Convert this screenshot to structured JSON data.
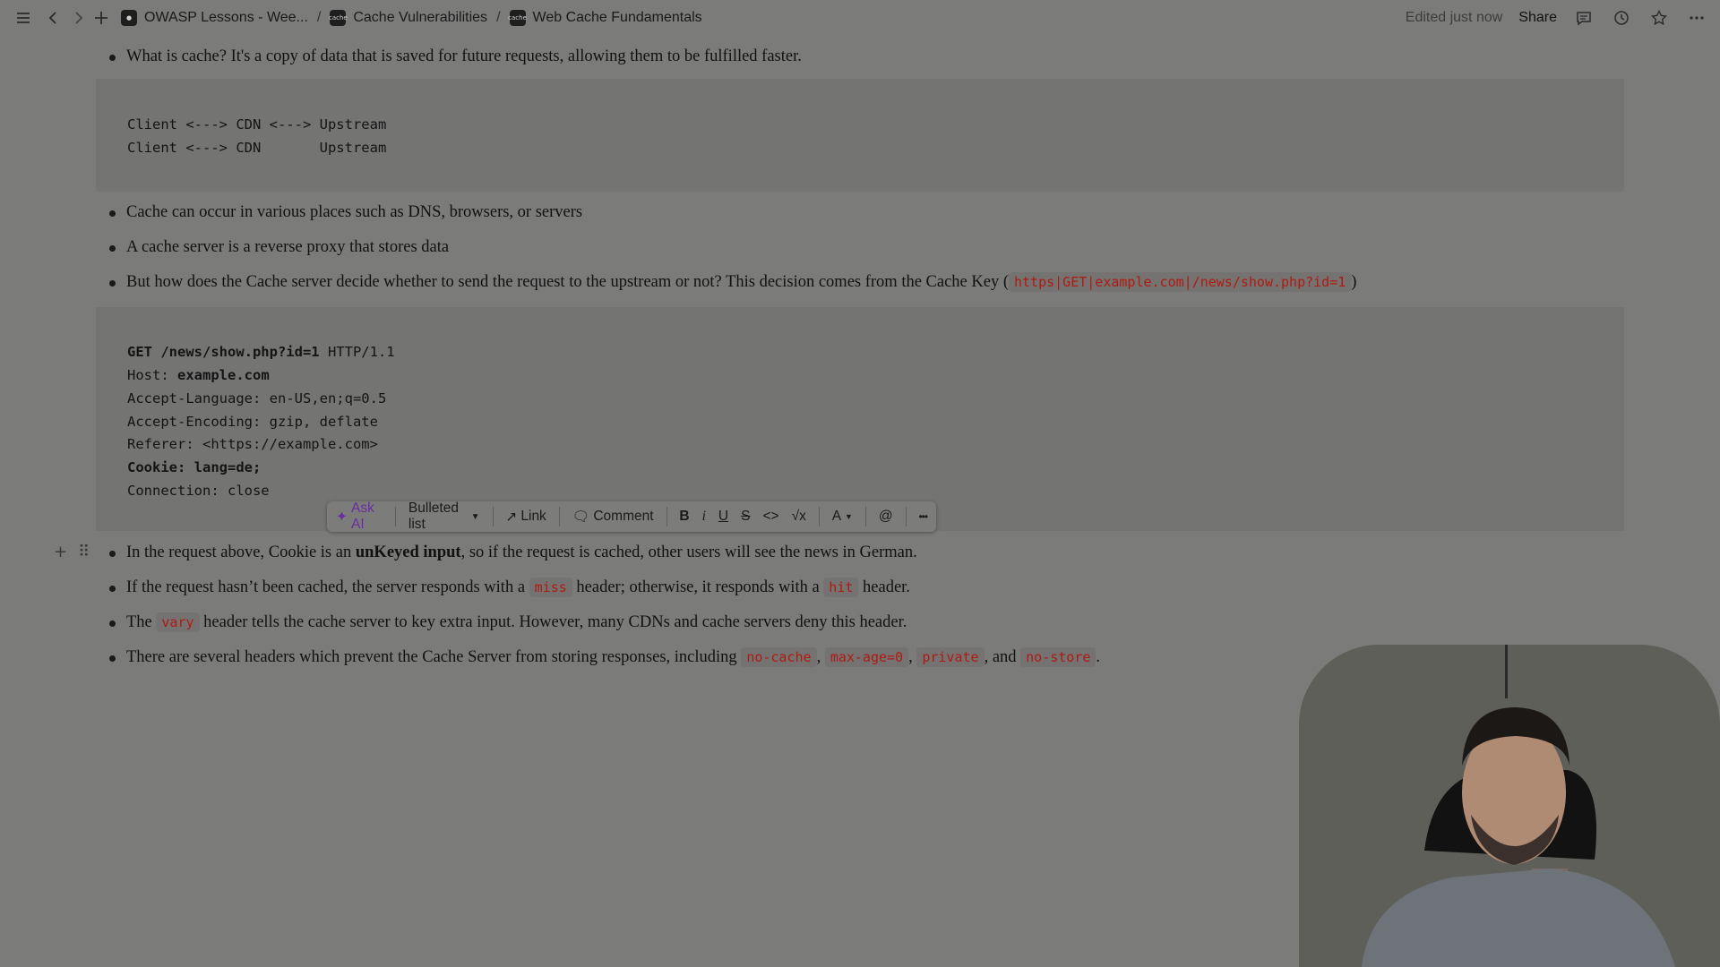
{
  "topbar": {
    "breadcrumbs": [
      {
        "label": "OWASP Lessons - Wee...",
        "icon": "owasp-icon"
      },
      {
        "label": "Cache Vulnerabilities",
        "icon": "cache-icon"
      },
      {
        "label": "Web Cache Fundamentals",
        "icon": "cache-icon"
      }
    ],
    "separator": "/",
    "edited": "Edited just now",
    "share": "Share",
    "crumb_icon_text": "cache"
  },
  "content": {
    "bullet1": "What is cache? It's a copy of data that is saved for future requests, allowing them to be fulfilled faster.",
    "code1": [
      "Client <---> CDN <---> Upstream",
      "Client <---> CDN       Upstream"
    ],
    "bullet2": "Cache can occur in various places such as DNS, browsers, or servers",
    "bullet3": "A cache server is a reverse proxy that stores data",
    "bullet4_pre": "But how does the Cache server decide whether to send the request to the upstream or not? This decision comes from the Cache Key (",
    "bullet4_code": "https|GET|example.com|/news/show.php?id=1",
    "bullet4_post": ")",
    "code2": {
      "l1_bold": "GET /news/show.php?id=1",
      "l1_rest": " HTTP/1.1",
      "l2_pre": "Host: ",
      "l2_bold": "example.com",
      "l3": "Accept-Language: en-US,en;q=0.5",
      "l4": "Accept-Encoding: gzip, deflate",
      "l5": "Referer: <https://example.com>",
      "l6_bold": "Cookie: lang=de;",
      "l7": "Connection: close"
    },
    "bullet5_pre": "In the request above, Cookie is an ",
    "bullet5_bold": "unKeyed input",
    "bullet5_post": ", so if the request is cached, other users will see the news in German.",
    "bullet6_pre": "If the request hasn’t been cached, the server responds with a ",
    "bullet6_code1": "miss",
    "bullet6_mid": " header; otherwise, it responds with a ",
    "bullet6_code2": "hit",
    "bullet6_post": " header.",
    "bullet7_pre": "The ",
    "bullet7_code": "vary",
    "bullet7_post": " header tells the cache server to key extra input. However, many CDNs and cache servers deny this header.",
    "bullet8_pre": "There are several headers which prevent the Cache Server from storing responses, including ",
    "bullet8_code1": "no-cache",
    "bullet8_sep1": ", ",
    "bullet8_code2": "max-age=0",
    "bullet8_sep2": ", ",
    "bullet8_code3": "private",
    "bullet8_and": ", and ",
    "bullet8_code4": "no-store",
    "bullet8_end": "."
  },
  "toolbar": {
    "ask_ai": "Ask AI",
    "block_type": "Bulleted list",
    "link": "Link",
    "comment": "Comment",
    "bold": "B",
    "italic": "i",
    "underline": "U",
    "strike": "S",
    "code": "<>",
    "equation": "√x",
    "text_color": "A",
    "mention": "@",
    "more": "•••"
  },
  "colors": {
    "code_text": "#b01a10",
    "ask_ai": "#6a2ca0"
  }
}
